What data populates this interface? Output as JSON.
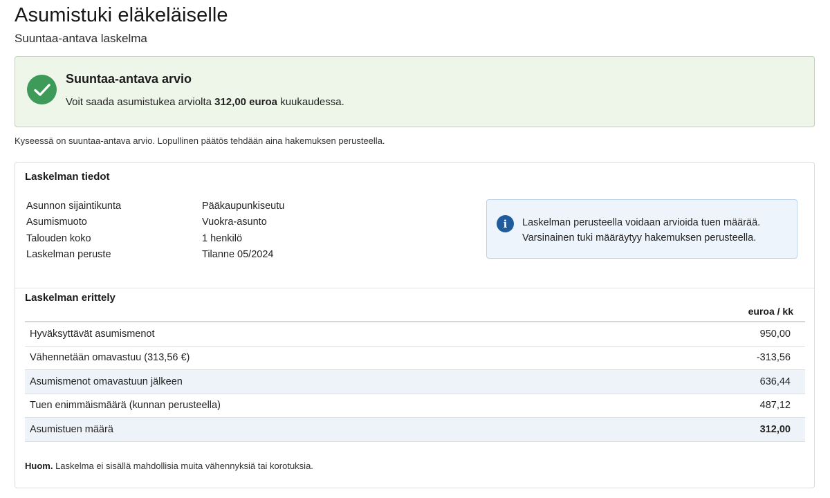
{
  "header": {
    "title": "Asumistuki eläkeläiselle",
    "subtitle": "Suuntaa-antava laskelma"
  },
  "result": {
    "icon": "check-icon",
    "title": "Suuntaa-antava arvio",
    "text_before": "Voit saada asumistukea arviolta ",
    "amount": "312,00 euroa",
    "text_after": " kuukaudessa.",
    "accent_color": "#3d9a59"
  },
  "disclaimer": "Kyseessä on suuntaa-antava arvio. Lopullinen päätös tehdään aina hakemuksen perusteella.",
  "details": {
    "title": "Laskelman tiedot",
    "rows": [
      {
        "label": "Asunnon sijaintikunta",
        "value": "Pääkaupunkiseutu"
      },
      {
        "label": "Asumismuoto",
        "value": "Vuokra-asunto"
      },
      {
        "label": "Talouden koko",
        "value": "1 henkilö"
      },
      {
        "label": "Laskelman peruste",
        "value": "Tilanne 05/2024"
      }
    ]
  },
  "notice": {
    "icon": "info-icon",
    "line1": "Laskelman perusteella voidaan arvioida tuen määrää.",
    "line2": "Varsinainen tuki määräytyy hakemuksen perusteella.",
    "accent_color": "#205c9c"
  },
  "breakdown": {
    "title": "Laskelman erittely",
    "column_header": "euroa / kk",
    "rows": [
      {
        "label": "Hyväksyttävät asumismenot",
        "value": "950,00"
      },
      {
        "label": "Vähennetään omavastuu (313,56 €)",
        "value": "-313,56"
      },
      {
        "label": "Asumismenot omavastuun jälkeen",
        "value": "636,44"
      },
      {
        "label": "Tuen enimmäismäärä (kunnan perusteella)",
        "value": "487,12"
      },
      {
        "label": "Asumistuen määrä",
        "value": "312,00"
      }
    ]
  },
  "footnote": {
    "bold": "Huom.",
    "text": " Laskelma ei sisällä mahdollisia muita vähennyksiä tai korotuksia."
  }
}
